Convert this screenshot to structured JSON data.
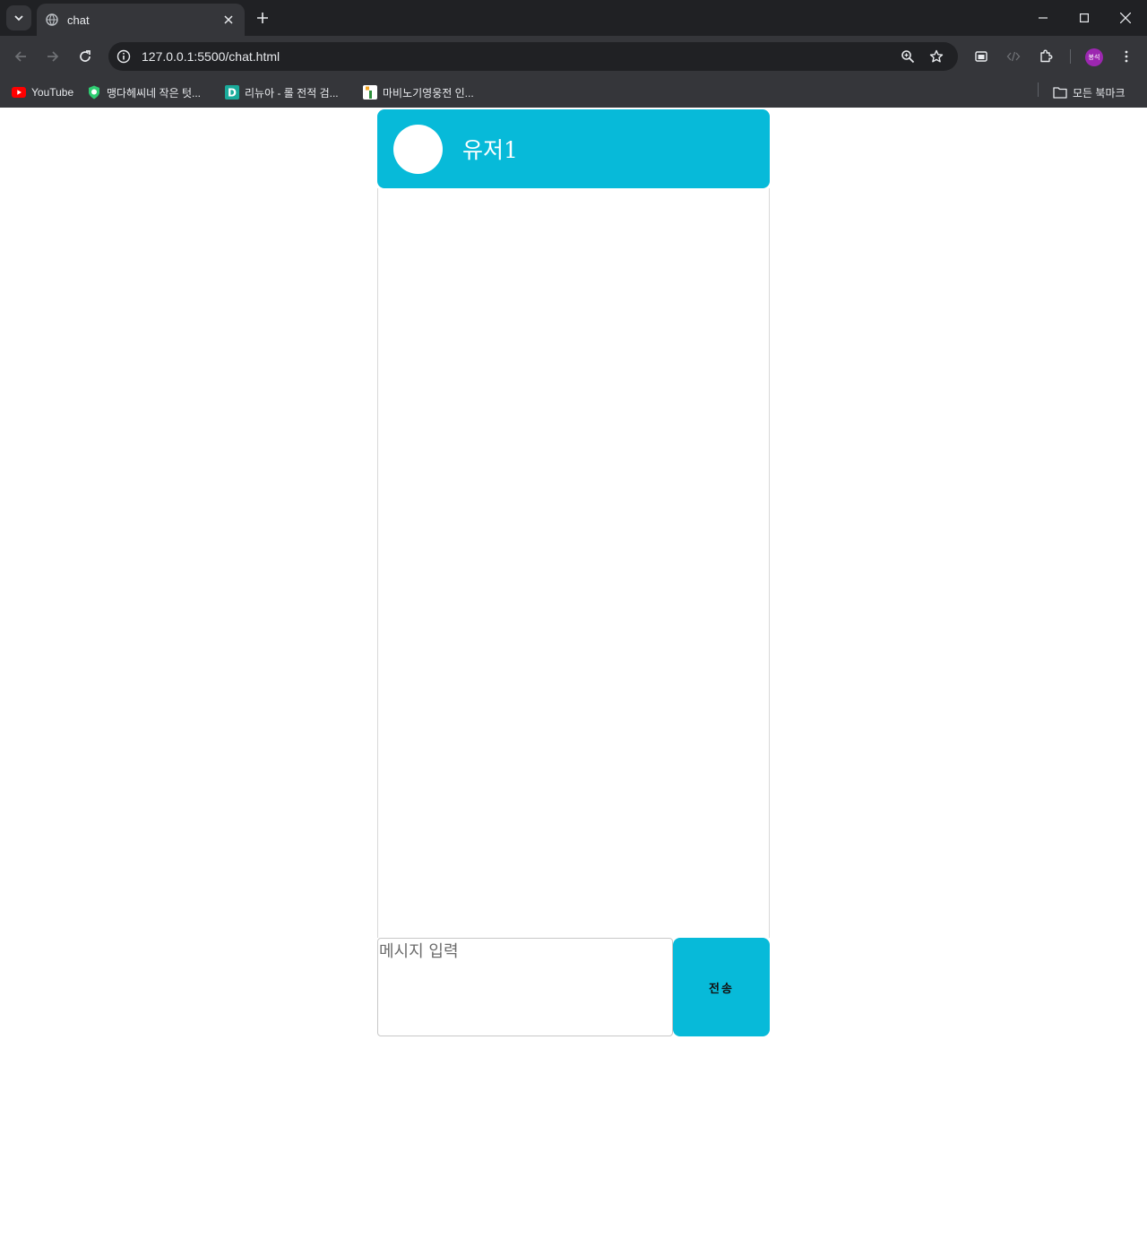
{
  "browser": {
    "tab": {
      "title": "chat"
    },
    "address": {
      "url": "127.0.0.1:5500/chat.html"
    },
    "profile": {
      "label": "봉석"
    },
    "bookmarks": [
      {
        "label": "YouTube"
      },
      {
        "label": "맹다헤씨네 작은 텃..."
      },
      {
        "label": "리뉴아 - 롤 전적 검..."
      },
      {
        "label": "마비노기영웅전 인..."
      }
    ],
    "all_bookmarks": "모든 북마크"
  },
  "chat": {
    "header": {
      "username": "유저1"
    },
    "input": {
      "placeholder": "메시지 입력"
    },
    "send_label": "전송"
  },
  "colors": {
    "accent": "#07bad9"
  }
}
